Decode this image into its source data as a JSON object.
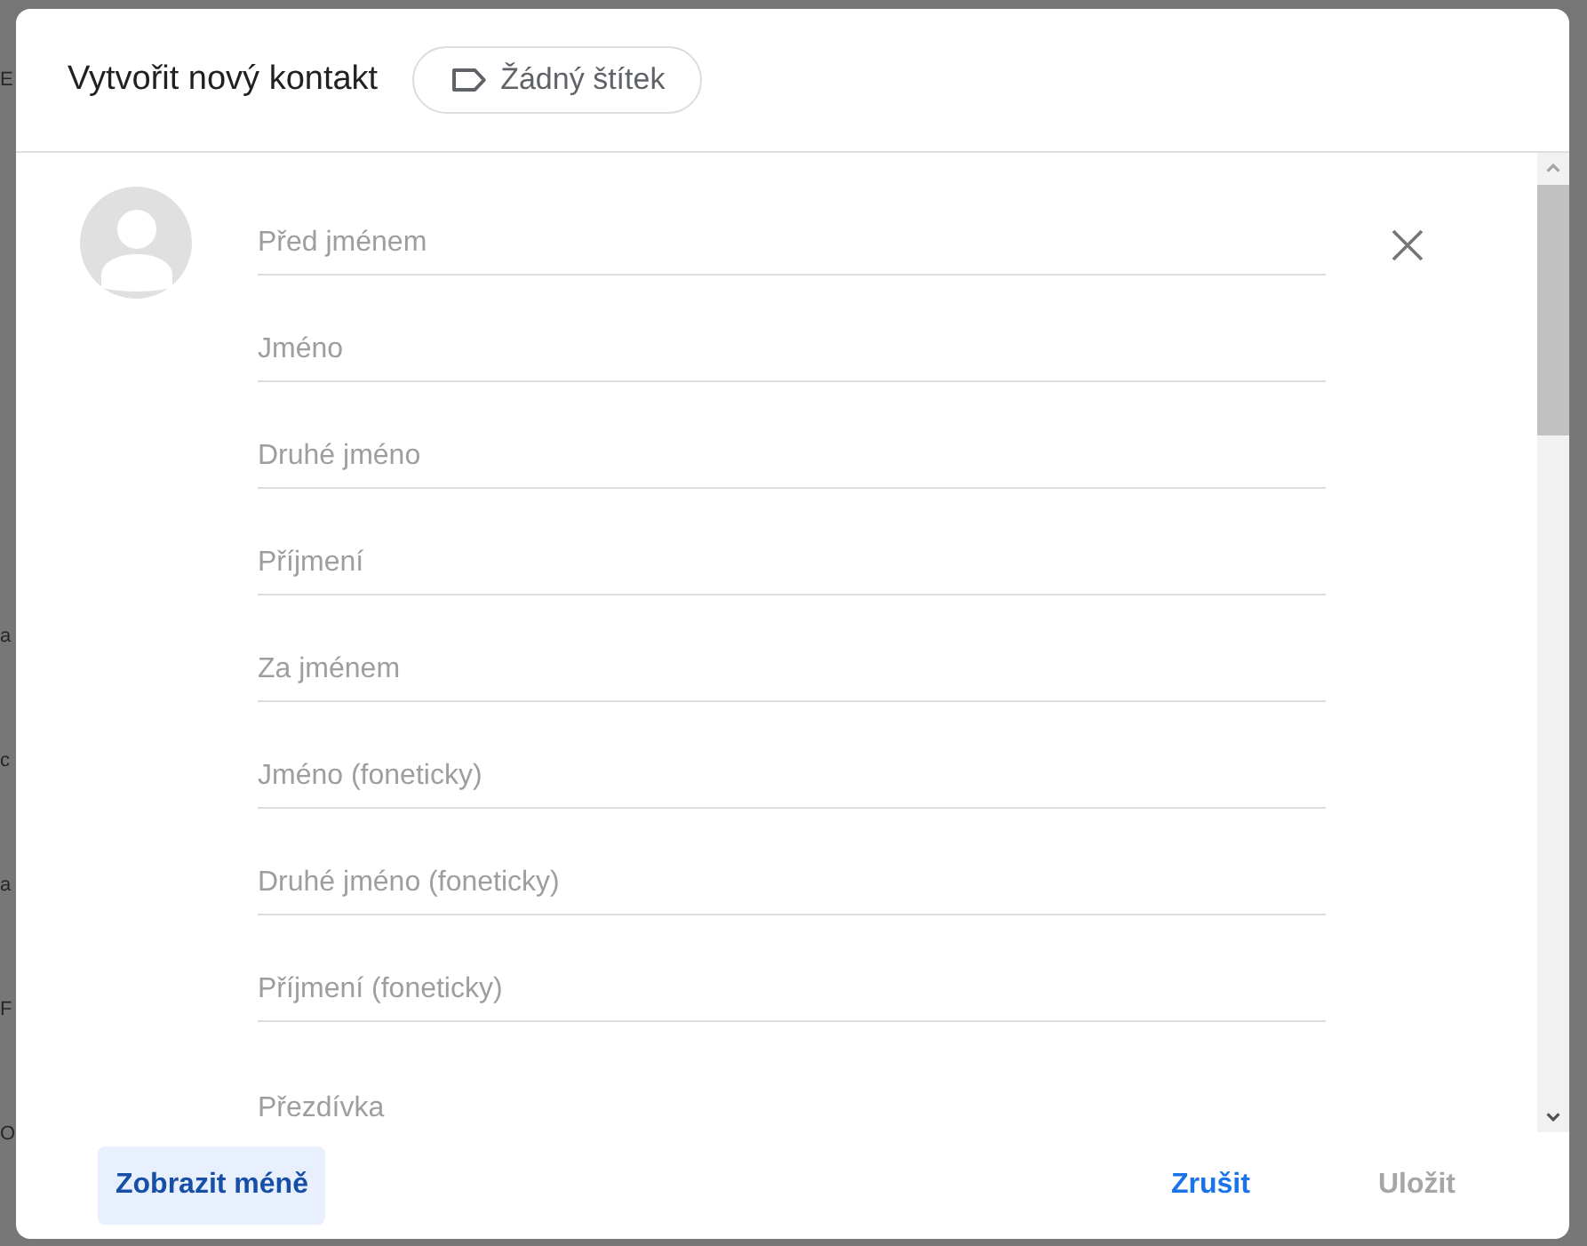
{
  "background_page": {
    "fragments": [
      "E",
      "a",
      "c",
      "a",
      "F",
      "O"
    ]
  },
  "dialog": {
    "title": "Vytvořit nový kontakt",
    "label_chip": {
      "label": "Žádný štítek"
    }
  },
  "fields": [
    {
      "placeholder": "Před jménem"
    },
    {
      "placeholder": "Jméno"
    },
    {
      "placeholder": "Druhé jméno"
    },
    {
      "placeholder": "Příjmení"
    },
    {
      "placeholder": "Za jménem"
    },
    {
      "placeholder": "Jméno (foneticky)"
    },
    {
      "placeholder": "Druhé jméno (foneticky)"
    },
    {
      "placeholder": "Příjmení (foneticky)"
    }
  ],
  "nickname": {
    "placeholder": "Přezdívka"
  },
  "footer": {
    "toggle": {
      "label": "Zobrazit méně"
    },
    "actions": [
      {
        "label": "Zrušit",
        "disabled": false
      },
      {
        "label": "Uložit",
        "disabled": true
      }
    ]
  }
}
